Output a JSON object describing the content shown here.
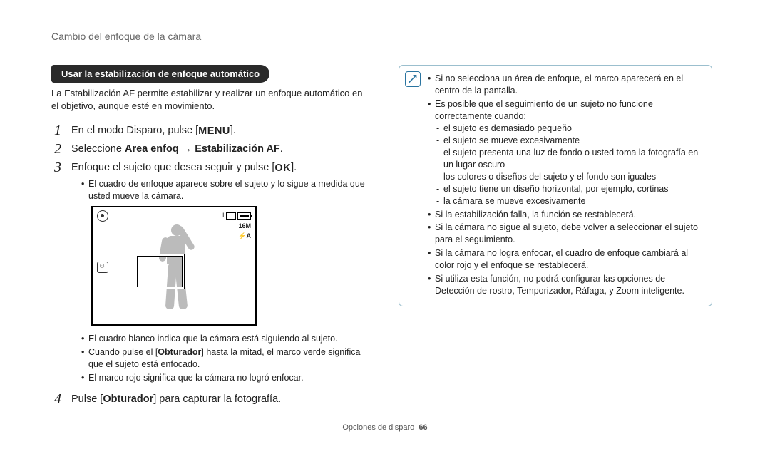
{
  "breadcrumb": "Cambio del enfoque de la cámara",
  "section": {
    "title": "Usar la estabilización de enfoque automático",
    "desc": "La Estabilización AF permite estabilizar y realizar un enfoque automático en el objetivo, aunque esté en movimiento."
  },
  "keys": {
    "menu": "MENU",
    "ok": "OK"
  },
  "steps": {
    "s1_pre": "En el modo Disparo, pulse [",
    "s1_post": "].",
    "s2_pre": "Seleccione ",
    "s2_bold": "Area enfoq → Estabilización AF",
    "s2_post": ".",
    "s3_pre": "Enfoque el sujeto que desea seguir y pulse [",
    "s3_post": "].",
    "s3_sub1": "El cuadro de enfoque aparece sobre el sujeto y lo sigue a medida que usted mueve la cámara.",
    "s3_b1": "El cuadro blanco indica que la cámara está siguiendo al sujeto.",
    "s3_b2_pre": "Cuando pulse el [",
    "s3_b2_bold": "Obturador",
    "s3_b2_post": "] hasta la mitad, el marco verde significa que el sujeto está enfocado.",
    "s3_b3": "El marco rojo significa que la cámara no logró enfocar.",
    "s4_pre": "Pulse [",
    "s4_bold": "Obturador",
    "s4_post": "] para capturar la fotografía."
  },
  "lcd": {
    "right1_prefix": "I ",
    "right2": "16M",
    "right3": "⚡A",
    "right4": ""
  },
  "notes": {
    "n1": "Si no selecciona un área de enfoque, el marco aparecerá en el centro de la pantalla.",
    "n2": "Es posible que el seguimiento de un sujeto no funcione correctamente cuando:",
    "n2a": "el sujeto es demasiado pequeño",
    "n2b": "el sujeto se mueve excesivamente",
    "n2c": "el sujeto presenta una luz de fondo o usted toma la fotografía en un lugar oscuro",
    "n2d": "los colores o diseños del sujeto y el fondo son iguales",
    "n2e": "el sujeto tiene un diseño horizontal, por ejemplo, cortinas",
    "n2f": "la cámara se mueve excesivamente",
    "n3": "Si la estabilización falla, la función se restablecerá.",
    "n4": "Si la cámara no sigue al sujeto, debe volver a seleccionar el sujeto para el seguimiento.",
    "n5": "Si la cámara no logra enfocar, el cuadro de enfoque cambiará al color rojo y el enfoque se restablecerá.",
    "n6": "Si utiliza esta función, no podrá configurar las opciones de Detección de rostro, Temporizador, Ráfaga, y Zoom inteligente."
  },
  "footer": {
    "section": "Opciones de disparo",
    "page": "66"
  }
}
